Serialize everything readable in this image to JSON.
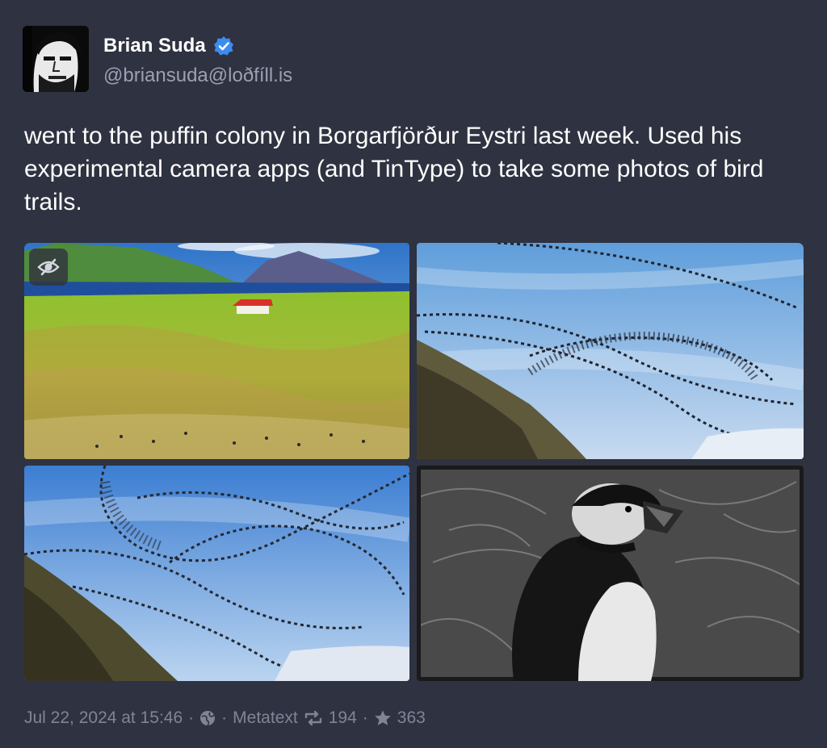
{
  "author": {
    "display_name": "Brian Suda",
    "handle": "@briansuda@loðfíll.is",
    "verified_icon": "verified-badge-icon",
    "avatar_icon": "avatar-portrait"
  },
  "post": {
    "text": "went to the puffin colony in Borgarfjörður Eystri last week. Used his experimental camera apps (and TinType) to take some photos of bird trails."
  },
  "media": {
    "hide_icon": "eye-slash-icon",
    "images": [
      {
        "subject": "green hillside with red-roofed house, fjord and mountains"
      },
      {
        "subject": "spiral trails of flying puffins over cliff"
      },
      {
        "subject": "swirling bird trails above grassy slope"
      },
      {
        "subject": "black-and-white tintype portrait of a puffin"
      }
    ]
  },
  "footer": {
    "timestamp": "Jul 22, 2024 at 15:46",
    "separator": "·",
    "visibility_icon": "globe-icon",
    "client": "Metatext",
    "boost_icon": "boost-icon",
    "boosts": "194",
    "favourite_icon": "star-icon",
    "favourites": "363"
  },
  "colors": {
    "background": "#2f3240",
    "text": "#ffffff",
    "muted": "#9ba0b3",
    "footer": "#7f8498",
    "verified": "#3b8cf0"
  }
}
